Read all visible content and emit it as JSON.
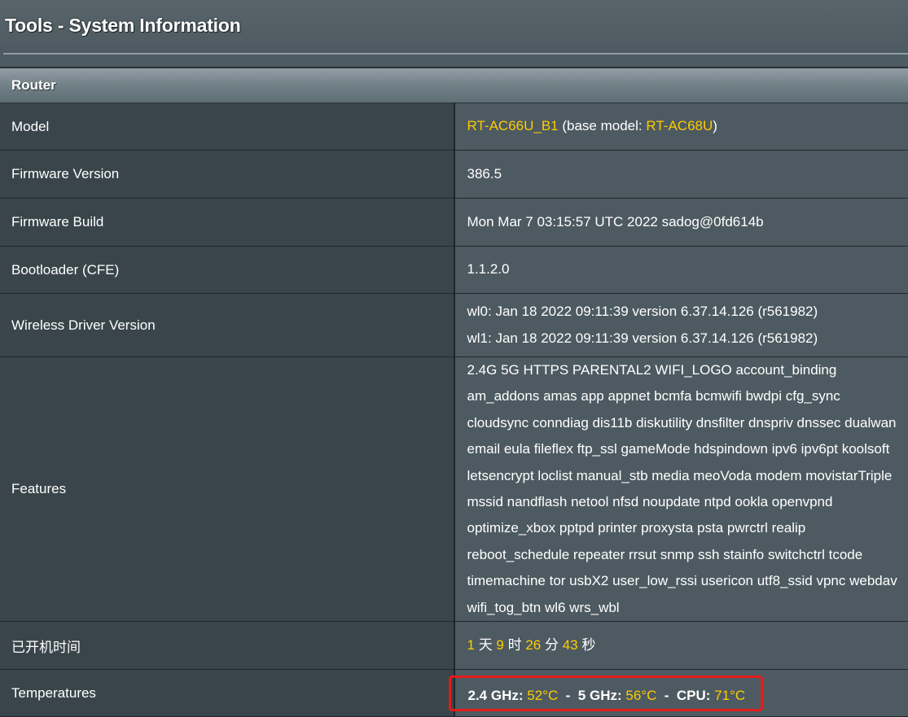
{
  "page": {
    "title": "Tools - System Information"
  },
  "router": {
    "section_title": "Router",
    "model": {
      "label": "Model",
      "name": "RT-AC66U_B1",
      "base_prefix": " (base model: ",
      "base_name": "RT-AC68U",
      "base_suffix": ")"
    },
    "firmware_version": {
      "label": "Firmware Version",
      "value": "386.5"
    },
    "firmware_build": {
      "label": "Firmware Build",
      "value": "Mon Mar 7 03:15:57 UTC 2022 sadog@0fd614b"
    },
    "bootloader": {
      "label": "Bootloader (CFE)",
      "value": "1.1.2.0"
    },
    "wireless_driver": {
      "label": "Wireless Driver Version",
      "wl0": "wl0: Jan 18 2022 09:11:39 version 6.37.14.126 (r561982)",
      "wl1": "wl1: Jan 18 2022 09:11:39 version 6.37.14.126 (r561982)"
    },
    "features": {
      "label": "Features",
      "value": "2.4G 5G HTTPS PARENTAL2 WIFI_LOGO account_binding am_addons amas app appnet bcmfa bcmwifi bwdpi cfg_sync cloudsync conndiag dis11b diskutility dnsfilter dnspriv dnssec dualwan email eula fileflex ftp_ssl gameMode hdspindown ipv6 ipv6pt koolsoft letsencrypt loclist manual_stb media meoVoda modem movistarTriple mssid nandflash netool nfsd noupdate ntpd ookla openvpnd optimize_xbox pptpd printer proxysta psta pwrctrl realip reboot_schedule repeater rrsut snmp ssh stainfo switchctrl tcode timemachine tor usbX2 user_low_rssi usericon utf8_ssid vpnc webdav wifi_tog_btn wl6 wrs_wbl"
    },
    "uptime": {
      "label": "已开机时间",
      "days": "1",
      "days_unit": " 天 ",
      "hours": "9",
      "hours_unit": " 时 ",
      "minutes": "26",
      "minutes_unit": " 分 ",
      "seconds": "43",
      "seconds_unit": " 秒"
    },
    "temperatures": {
      "label": "Temperatures",
      "ghz24_label": "2.4 GHz: ",
      "ghz24_value": "52°C",
      "sep1": "  -  ",
      "ghz5_label": "5 GHz: ",
      "ghz5_value": "56°C",
      "sep2": "  -  ",
      "cpu_label": "CPU: ",
      "cpu_value": "71°C"
    }
  },
  "colors": {
    "highlight": "#ffcc00",
    "annotation_box": "#e31b1b",
    "label_bg": "#39454b",
    "value_bg": "#4d5a61"
  }
}
